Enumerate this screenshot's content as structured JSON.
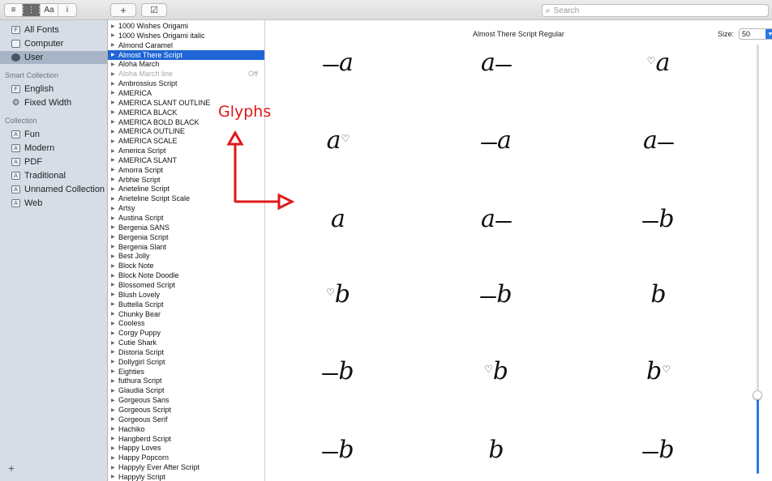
{
  "toolbar": {
    "view_buttons": [
      "≡",
      "⋮⋮⋮",
      "Aa",
      "i"
    ],
    "add_label": "+",
    "validate_label": "☑",
    "search_placeholder": "Search"
  },
  "sidebar": {
    "library_items": [
      {
        "label": "All Fonts",
        "icon": "font-book-icon"
      },
      {
        "label": "Computer",
        "icon": "computer-icon"
      },
      {
        "label": "User",
        "icon": "user-icon",
        "selected": true
      }
    ],
    "smart_collection_heading": "Smart Collection",
    "smart_items": [
      {
        "label": "English",
        "icon": "font-book-icon"
      },
      {
        "label": "Fixed Width",
        "icon": "gear-icon"
      }
    ],
    "collection_heading": "Collection",
    "collection_items": [
      {
        "label": "Fun"
      },
      {
        "label": "Modern"
      },
      {
        "label": "PDF"
      },
      {
        "label": "Traditional"
      },
      {
        "label": "Unnamed Collection"
      },
      {
        "label": "Web"
      }
    ],
    "add_label": "+"
  },
  "font_list": [
    "1000 Wishes Origami",
    "1000 Wishes Origami italic",
    "Almond Caramel",
    "Almost There Script",
    "Aloha March",
    "Aloha March line",
    "Ambrossius Script",
    "AMERICA",
    "AMERICA  SLANT OUTLINE",
    "AMERICA BLACK",
    "AMERICA BOLD BLACK",
    "AMERICA OUTLINE",
    "AMERICA SCALE",
    "America Script",
    "AMERICA SLANT",
    "Amorra Script",
    "Arbhie Script",
    "Arieteline Script",
    "Arieteline Script Scale",
    "Artsy",
    "Austina Script",
    "Bergenia SANS",
    "Bergenia Script",
    "Bergenia Slant",
    "Best Jolly",
    "Block Note",
    "Block Note Doodle",
    "Blossomed Script",
    "Blush Lovely",
    "Buttella Script",
    "Chunky Bear",
    "Cooless",
    "Corgy Puppy",
    "Cutie Shark",
    "Distoria Script",
    "Dollygirl Script",
    "Eighties",
    "futhura Script",
    "Glaudia Script",
    "Gorgeous Sans",
    "Gorgeous Script",
    "Gorgeous Serif",
    "Hachiko",
    "Hangberd Script",
    "Happy Loves",
    "Happy Popcorn",
    "Happyly Ever After Script",
    "Happyly Script"
  ],
  "font_list_selected_index": 3,
  "font_list_disabled_index": 5,
  "font_list_off_label": "Off",
  "preview": {
    "title": "Almost There Script Regular",
    "size_label": "Size:",
    "size_value": "50",
    "size_slider_fraction": 0.18,
    "glyphs": [
      {
        "char": "a",
        "variant": "swash-left"
      },
      {
        "char": "a",
        "variant": "swash-right"
      },
      {
        "char": "a",
        "variant": "heart-left"
      },
      {
        "char": "a",
        "variant": "heart-right"
      },
      {
        "char": "a",
        "variant": "swash-left"
      },
      {
        "char": "a",
        "variant": "swash-right"
      },
      {
        "char": "a",
        "variant": "plain"
      },
      {
        "char": "a",
        "variant": "swash-right"
      },
      {
        "char": "b",
        "variant": "swash-left"
      },
      {
        "char": "b",
        "variant": "heart-left"
      },
      {
        "char": "b",
        "variant": "swash-left"
      },
      {
        "char": "b",
        "variant": "plain"
      },
      {
        "char": "b",
        "variant": "swash-left"
      },
      {
        "char": "b",
        "variant": "heart-left"
      },
      {
        "char": "b",
        "variant": "heart-right"
      },
      {
        "char": "b",
        "variant": "swash-left"
      },
      {
        "char": "b",
        "variant": "plain"
      },
      {
        "char": "b",
        "variant": "swash-left"
      }
    ]
  },
  "annotation": {
    "label": "Glyphs",
    "color": "#e01818"
  },
  "colors": {
    "selection": "#1f65d6",
    "sidebar_bg": "#d6dde6",
    "accent": "#2a78e4"
  }
}
